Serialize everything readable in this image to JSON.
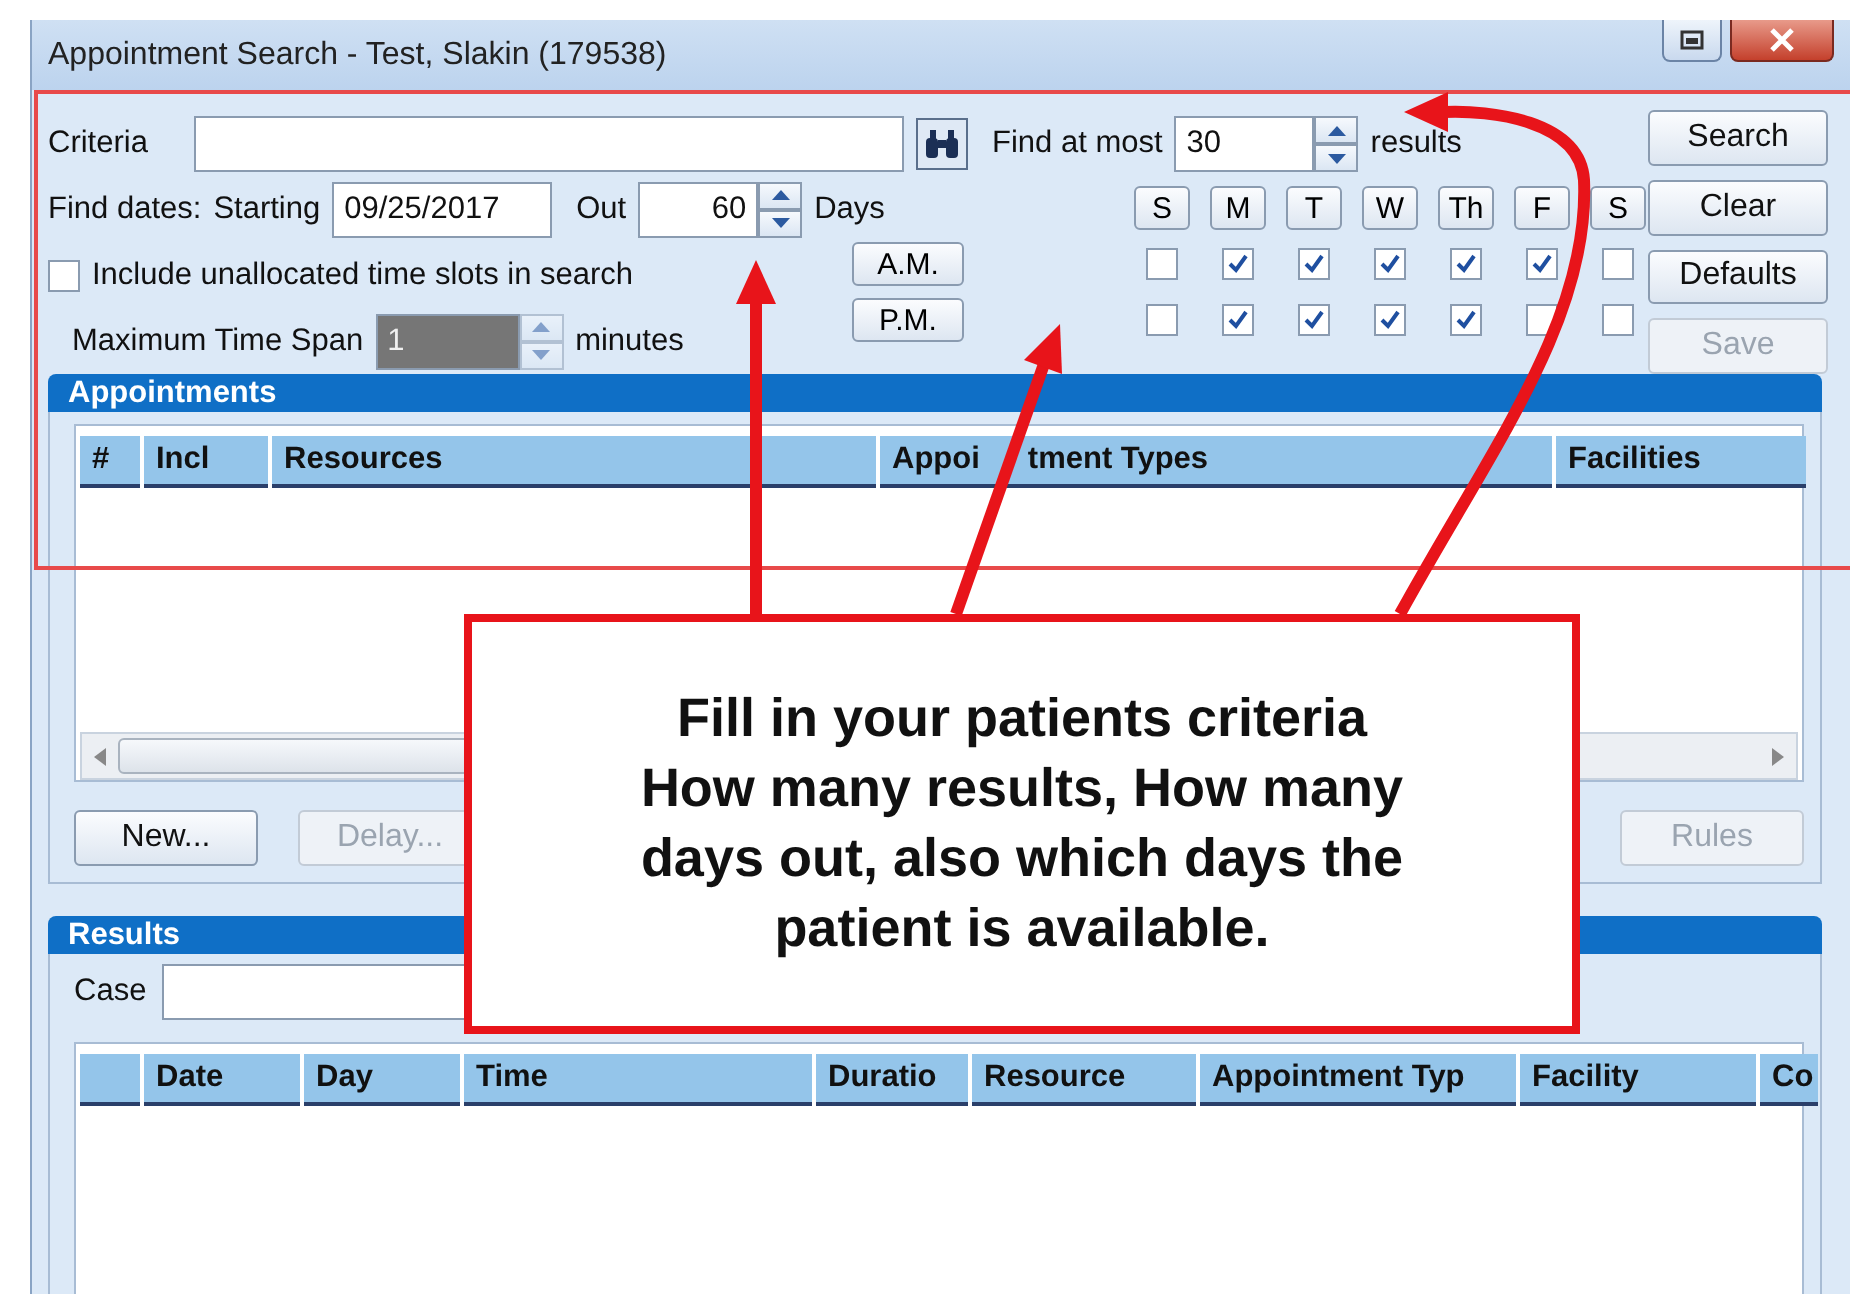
{
  "window": {
    "title": "Appointment Search - Test, Slakin (179538)"
  },
  "criteria": {
    "label": "Criteria"
  },
  "find_at_most": {
    "label": "Find at most",
    "value": "30",
    "suffix": "results"
  },
  "find_dates": {
    "label": "Find dates:",
    "starting_label": "Starting",
    "starting_value": "09/25/2017",
    "out_label": "Out",
    "out_value": "60",
    "days_label": "Days"
  },
  "include_unallocated": {
    "label": "Include unallocated time slots in search",
    "checked": false
  },
  "max_time_span": {
    "label": "Maximum Time Span",
    "value": "1",
    "suffix": "minutes",
    "disabled": true
  },
  "days": [
    "S",
    "M",
    "T",
    "W",
    "Th",
    "F",
    "S"
  ],
  "periods": [
    {
      "label": "A.M.",
      "slots": [
        {
          "checked": false
        },
        {
          "checked": true
        },
        {
          "checked": true
        },
        {
          "checked": true
        },
        {
          "checked": true
        },
        {
          "checked": true
        },
        {
          "checked": false
        }
      ]
    },
    {
      "label": "P.M.",
      "slots": [
        {
          "checked": false
        },
        {
          "checked": true
        },
        {
          "checked": true
        },
        {
          "checked": true
        },
        {
          "checked": true
        },
        {
          "checked": false
        },
        {
          "checked": false
        }
      ]
    }
  ],
  "buttons": [
    {
      "label": "Search",
      "disabled": false
    },
    {
      "label": "Clear",
      "disabled": false
    },
    {
      "label": "Defaults",
      "disabled": false
    },
    {
      "label": "Save",
      "disabled": true
    }
  ],
  "appointments": {
    "title": "Appointments",
    "columns": [
      {
        "parts": [
          "#"
        ]
      },
      {
        "parts": [
          "Incl"
        ]
      },
      {
        "parts": [
          "Resources"
        ]
      },
      {
        "parts": [
          "Appoi",
          "tment Types"
        ]
      },
      {
        "parts": [
          "Facilities"
        ]
      }
    ],
    "buttons": [
      {
        "label": "New...",
        "disabled": false
      },
      {
        "label": "Delay...",
        "disabled": true
      },
      {
        "label": "Rules",
        "disabled": true
      }
    ]
  },
  "results": {
    "title": "Results",
    "case_label": "Case",
    "columns": [
      "Date",
      "Day",
      "Time",
      "Duratio",
      "Resource",
      "Appointment Typ",
      "Facility",
      "Co"
    ]
  },
  "callout": {
    "lines": [
      "Fill in your patients criteria",
      "How many results, How many",
      "days out, also which days the",
      "patient is available."
    ]
  }
}
